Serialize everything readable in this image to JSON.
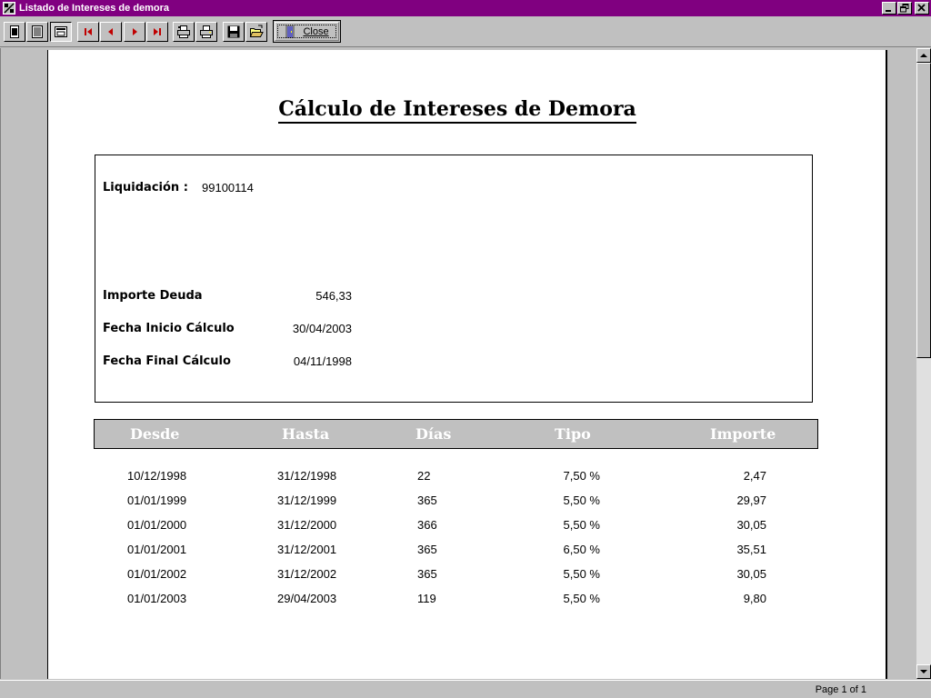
{
  "window": {
    "title": "Listado de Intereses de demora"
  },
  "toolbar": {
    "close_label": "Close"
  },
  "report": {
    "title": "Cálculo de Intereses de Demora",
    "liquidacion_label": "Liquidación :",
    "liquidacion_value": "99100114",
    "importe_label": "Importe Deuda",
    "importe_value": "546,33",
    "fecha_inicio_label": "Fecha Inicio Cálculo",
    "fecha_inicio_value": "30/04/2003",
    "fecha_final_label": "Fecha Final Cálculo",
    "fecha_final_value": "04/11/1998"
  },
  "table": {
    "headers": [
      "Desde",
      "Hasta",
      "Días",
      "Tipo",
      "Importe"
    ],
    "rows": [
      [
        "10/12/1998",
        "31/12/1998",
        "22",
        "7,50 %",
        "2,47"
      ],
      [
        "01/01/1999",
        "31/12/1999",
        "365",
        "5,50 %",
        "29,97"
      ],
      [
        "01/01/2000",
        "31/12/2000",
        "366",
        "5,50 %",
        "30,05"
      ],
      [
        "01/01/2001",
        "31/12/2001",
        "365",
        "6,50 %",
        "35,51"
      ],
      [
        "01/01/2002",
        "31/12/2002",
        "365",
        "5,50 %",
        "30,05"
      ],
      [
        "01/01/2003",
        "29/04/2003",
        "119",
        "5,50 %",
        "9,80"
      ]
    ]
  },
  "status": {
    "page_text": "Page 1 of 1"
  },
  "colors": {
    "titlebar": "#800080",
    "background": "#c0c0c0",
    "header_fill": "#c0c0c0"
  },
  "icons": [
    "app-icon",
    "minimize-icon",
    "restore-icon",
    "close-window-icon",
    "one-page-icon",
    "two-page-icon",
    "zoom-page-icon",
    "first-page-icon",
    "previous-page-icon",
    "next-page-icon",
    "last-page-icon",
    "print-setup-icon",
    "print-icon",
    "save-icon",
    "open-icon",
    "door-icon"
  ]
}
